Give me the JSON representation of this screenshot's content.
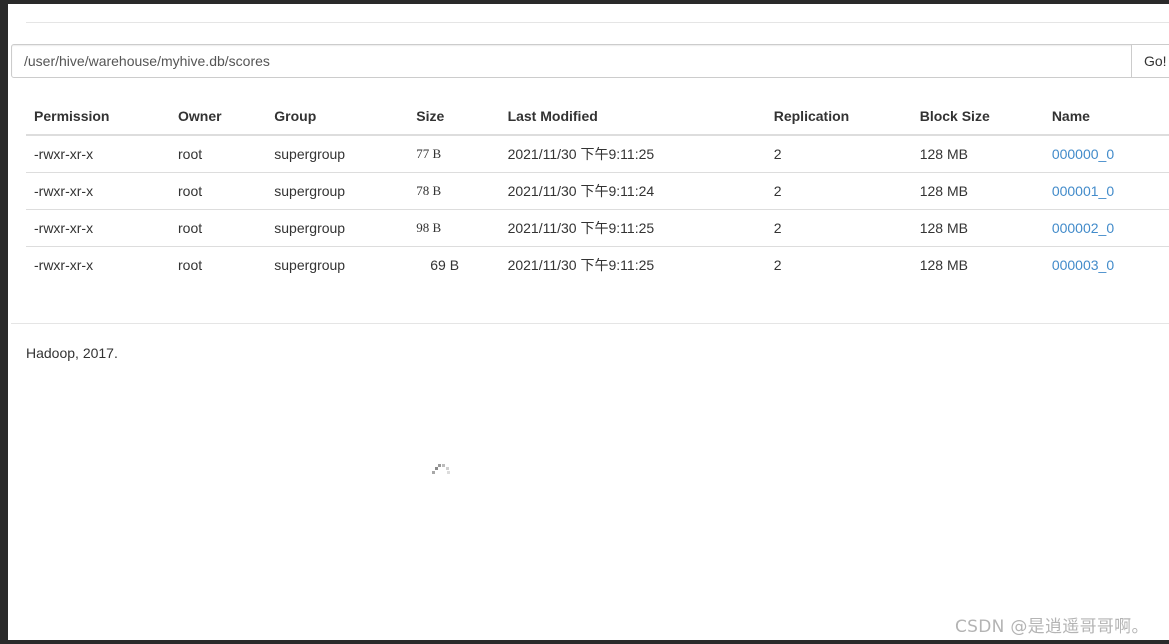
{
  "path_bar": {
    "value": "/user/hive/warehouse/myhive.db/scores",
    "go_label": "Go!"
  },
  "table": {
    "headers": {
      "permission": "Permission",
      "owner": "Owner",
      "group": "Group",
      "size": "Size",
      "last_modified": "Last Modified",
      "replication": "Replication",
      "block_size": "Block Size",
      "name": "Name"
    },
    "rows": [
      {
        "permission": "-rwxr-xr-x",
        "owner": "root",
        "group": "supergroup",
        "size": "77 B",
        "last_modified": "2021/11/30 下午9:11:25",
        "replication": "2",
        "block_size": "128 MB",
        "name": "000000_0"
      },
      {
        "permission": "-rwxr-xr-x",
        "owner": "root",
        "group": "supergroup",
        "size": "78 B",
        "last_modified": "2021/11/30 下午9:11:24",
        "replication": "2",
        "block_size": "128 MB",
        "name": "000001_0"
      },
      {
        "permission": "-rwxr-xr-x",
        "owner": "root",
        "group": "supergroup",
        "size": "98 B",
        "last_modified": "2021/11/30 下午9:11:25",
        "replication": "2",
        "block_size": "128 MB",
        "name": "000002_0"
      },
      {
        "permission": "-rwxr-xr-x",
        "owner": "root",
        "group": "supergroup",
        "size": "69 B",
        "last_modified": "2021/11/30 下午9:11:25",
        "replication": "2",
        "block_size": "128 MB",
        "name": "000003_0"
      }
    ]
  },
  "footer": {
    "text": "Hadoop, 2017."
  },
  "watermark": {
    "text": "CSDN @是逍遥哥哥啊。"
  },
  "colors": {
    "link": "#428bca",
    "text": "#333333",
    "border": "#dddddd"
  },
  "icons": {
    "spinner": "loading-spinner-icon"
  }
}
